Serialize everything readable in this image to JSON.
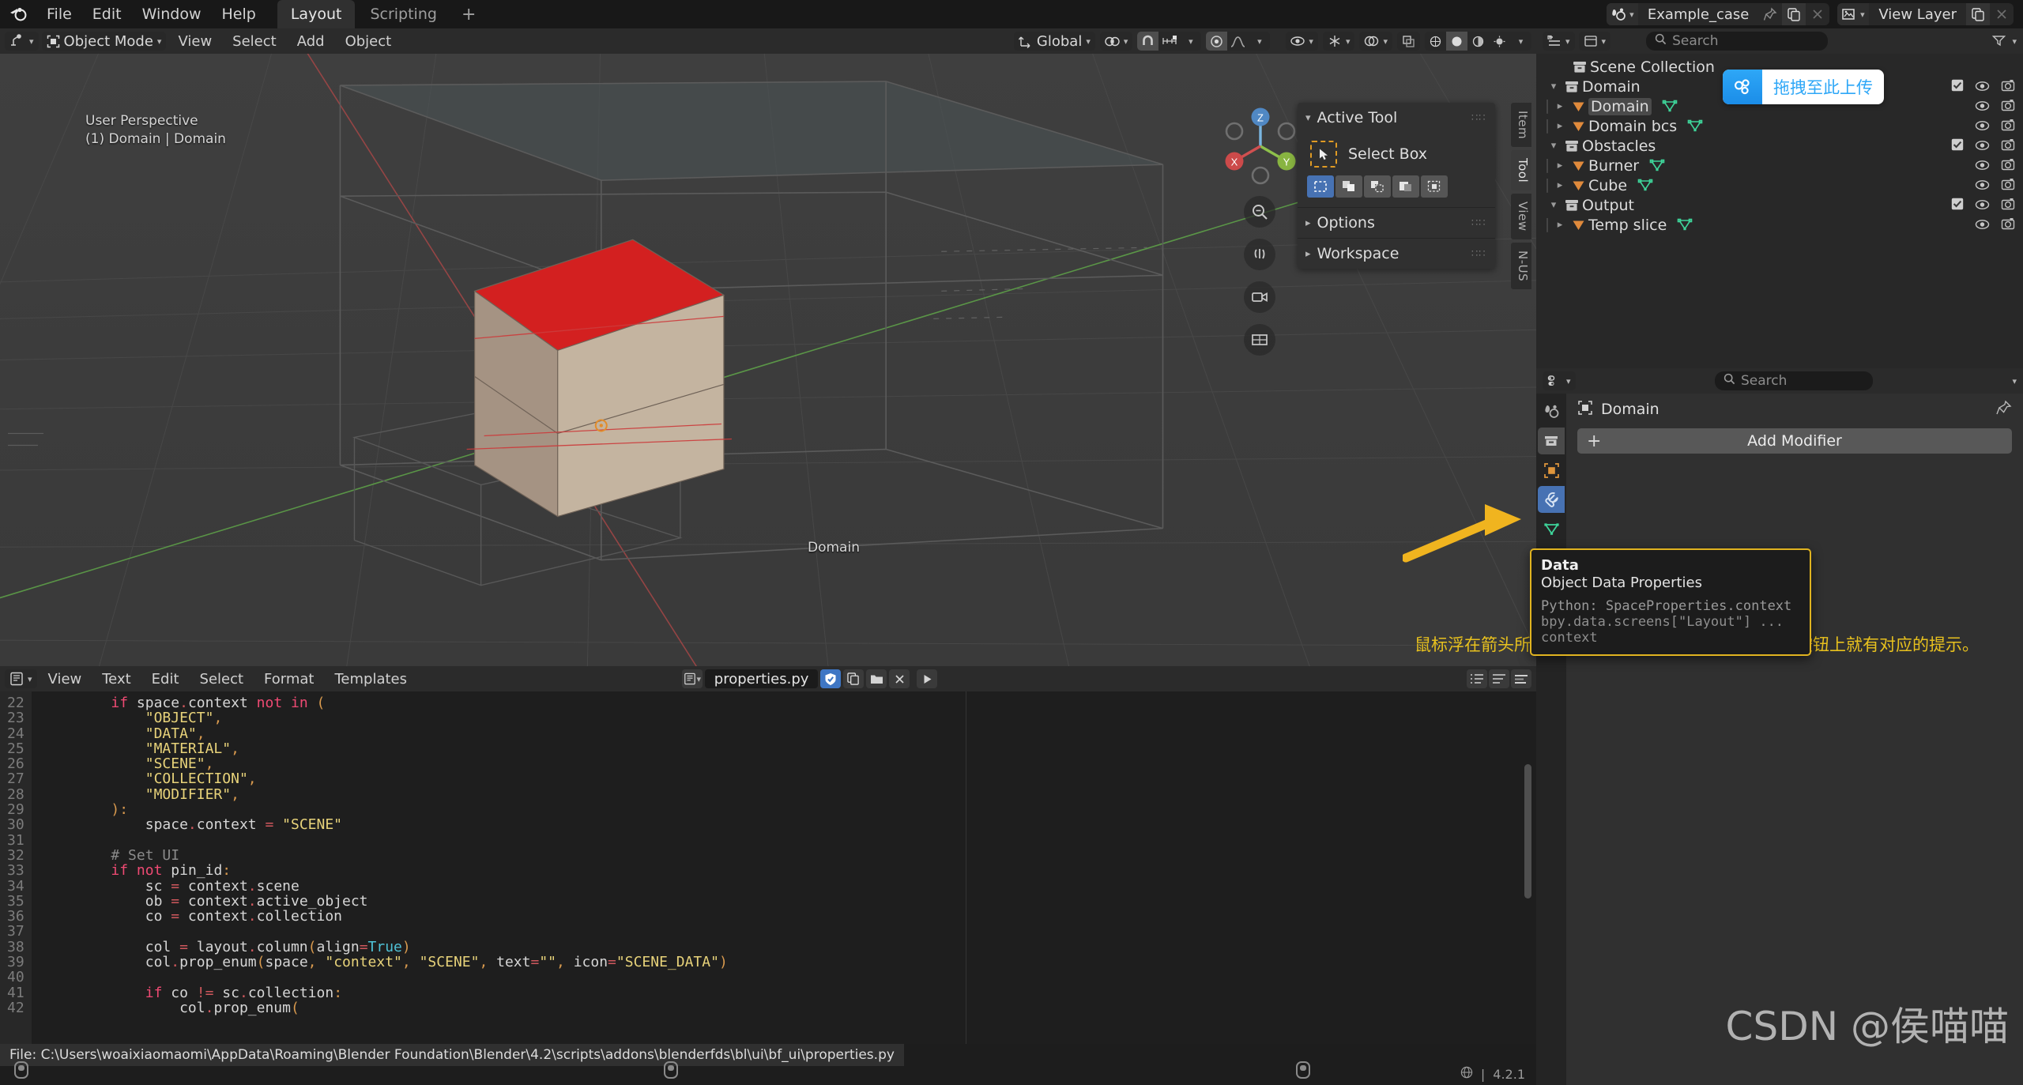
{
  "app": {
    "logo_icon": "blender-logo-icon",
    "version": "4.2.1"
  },
  "topbar": {
    "menus": [
      "File",
      "Edit",
      "Window",
      "Help"
    ],
    "workspaces": [
      {
        "label": "Layout",
        "active": true
      },
      {
        "label": "Scripting",
        "active": false
      }
    ],
    "add_workspace_label": "+",
    "scene": {
      "icon": "scene-icon",
      "name": "Example_case",
      "pin_icon": "pin-icon",
      "new_icon": "new-copy-icon",
      "unlink_icon": "close-icon"
    },
    "view_layer": {
      "icon": "view-layer-icon",
      "name": "View Layer",
      "new_icon": "new-copy-icon",
      "unlink_icon": "close-icon"
    }
  },
  "viewport": {
    "header": {
      "editor_type_icon": "editor-type-3dview-icon",
      "mode": "Object Mode",
      "mode_icon": "object-mode-icon",
      "menus": [
        "View",
        "Select",
        "Add",
        "Object"
      ],
      "transform_orientation": "Global",
      "orientation_icon": "orientation-gizmo-icon",
      "pivot_icon": "pivot-point-icon",
      "snap_magnet_icon": "snap-magnet-icon",
      "snap_target_icon": "snap-increment-icon",
      "proportional_icon": "proportional-editing-icon",
      "falloff_icon": "falloff-curve-icon",
      "shading_icons": [
        "wireframe-shading-icon",
        "solid-shading-icon",
        "material-shading-icon",
        "rendered-shading-icon"
      ],
      "overlay_icon": "overlays-icon",
      "xray_icon": "xray-toggle-icon",
      "gizmo_icon": "gizmo-toggle-icon",
      "visibility_icon": "object-visibility-icon"
    },
    "overlay_line1": "User Perspective",
    "overlay_line2": "(1) Domain | Domain",
    "object_label": "Domain",
    "gizmo_axes": [
      "X",
      "Y",
      "Z"
    ],
    "side_buttons": [
      "zoom-view-icon",
      "move-view-icon",
      "camera-view-icon",
      "toggle-ortho-icon"
    ]
  },
  "sidebar_n": {
    "sections": [
      {
        "label": "Active Tool",
        "expanded": true
      },
      {
        "label": "Options",
        "expanded": false
      },
      {
        "label": "Workspace",
        "expanded": false
      }
    ],
    "active_tool": {
      "name": "Select Box",
      "icon": "select-box-tool-icon",
      "modes": [
        "set-selection-icon",
        "extend-selection-icon",
        "subtract-selection-icon",
        "invert-selection-icon",
        "intersect-selection-icon"
      ],
      "active_mode_index": 0
    },
    "tabs": [
      "Item",
      "Tool",
      "View",
      "N-US"
    ]
  },
  "outliner": {
    "header": {
      "editor_type_icon": "editor-type-outliner-icon",
      "display_mode_icon": "outliner-display-mode-icon",
      "search_placeholder": "Search",
      "search_icon": "search-icon",
      "filter_icon": "filter-icon",
      "filter_chevron_icon": "chevron-down-icon"
    },
    "rows": [
      {
        "label": "Scene Collection",
        "icon": "collection-icon",
        "depth": 0,
        "twisty": "",
        "mesh": false,
        "checkbox": false,
        "eye": false,
        "camera": false
      },
      {
        "label": "Domain",
        "icon": "collection-icon",
        "depth": 1,
        "twisty": "v",
        "mesh": false,
        "checkbox": true,
        "eye": true,
        "camera": true
      },
      {
        "label": "Domain",
        "icon": "mesh-object-icon",
        "depth": 2,
        "twisty": ">",
        "mesh": true,
        "checkbox": false,
        "eye": true,
        "camera": true,
        "selected": true
      },
      {
        "label": "Domain bcs",
        "icon": "mesh-object-icon",
        "depth": 2,
        "twisty": ">",
        "mesh": true,
        "checkbox": false,
        "eye": true,
        "camera": true
      },
      {
        "label": "Obstacles",
        "icon": "collection-icon",
        "depth": 1,
        "twisty": "v",
        "mesh": false,
        "checkbox": true,
        "eye": true,
        "camera": true
      },
      {
        "label": "Burner",
        "icon": "mesh-object-icon",
        "depth": 2,
        "twisty": ">",
        "mesh": true,
        "checkbox": false,
        "eye": true,
        "camera": true
      },
      {
        "label": "Cube",
        "icon": "mesh-object-icon",
        "depth": 2,
        "twisty": ">",
        "mesh": true,
        "checkbox": false,
        "eye": true,
        "camera": true
      },
      {
        "label": "Output",
        "icon": "collection-icon",
        "depth": 1,
        "twisty": "v",
        "mesh": false,
        "checkbox": true,
        "eye": true,
        "camera": true
      },
      {
        "label": "Temp slice",
        "icon": "mesh-object-icon",
        "depth": 2,
        "twisty": ">",
        "mesh": true,
        "checkbox": false,
        "eye": true,
        "camera": true
      }
    ]
  },
  "properties": {
    "header": {
      "editor_type_icon": "editor-type-properties-icon",
      "search_placeholder": "Search",
      "search_icon": "search-icon",
      "options_chevron_icon": "chevron-down-icon"
    },
    "tabs": [
      {
        "name": "tool-properties-tab",
        "icon": "tool-tab-icon",
        "state": "normal"
      },
      {
        "name": "render-properties-tab",
        "icon": "collection-tab-icon",
        "state": "selected"
      },
      {
        "name": "object-properties-tab",
        "icon": "object-tab-icon",
        "state": "normal"
      },
      {
        "name": "modifier-properties-tab",
        "icon": "wrench-tab-icon",
        "state": "active"
      },
      {
        "name": "data-properties-tab",
        "icon": "mesh-data-tab-icon",
        "state": "normal"
      }
    ],
    "breadcrumb": {
      "icon": "object-icon",
      "label": "Domain",
      "pin_icon": "pin-icon"
    },
    "add_modifier_label": "Add Modifier",
    "add_modifier_plus": "+"
  },
  "tooltip": {
    "title": "Data",
    "subtitle": "Object Data Properties",
    "python_line": "Python: SpaceProperties.context",
    "path_line": "bpy.data.screens[\"Layout\"] ... context"
  },
  "annotation": {
    "text": "鼠标浮在箭头所指处，将有提示出现。只要浮在相关按钮上就有对应的提示。",
    "color": "#e8c11e",
    "arrow_color": "#f0b41f"
  },
  "text_editor": {
    "header": {
      "editor_type_icon": "editor-type-text-icon",
      "menus": [
        "View",
        "Text",
        "Edit",
        "Select",
        "Format",
        "Templates"
      ],
      "datablock_icon": "text-datablock-icon",
      "filename": "properties.py",
      "trusted_icon": "shield-check-icon",
      "copy_icon": "duplicate-icon",
      "open_icon": "folder-open-icon",
      "close_icon": "close-icon",
      "run_icon": "run-script-icon",
      "right_icons": [
        "line-numbers-icon",
        "word-wrap-icon",
        "syntax-highlight-icon"
      ]
    },
    "first_line_number": 22,
    "lines": [
      {
        "n": 22,
        "t": "        if space.context not in ("
      },
      {
        "n": 23,
        "t": "            \"OBJECT\","
      },
      {
        "n": 24,
        "t": "            \"DATA\","
      },
      {
        "n": 25,
        "t": "            \"MATERIAL\","
      },
      {
        "n": 26,
        "t": "            \"SCENE\","
      },
      {
        "n": 27,
        "t": "            \"COLLECTION\","
      },
      {
        "n": 28,
        "t": "            \"MODIFIER\","
      },
      {
        "n": 29,
        "t": "        ):"
      },
      {
        "n": 30,
        "t": "            space.context = \"SCENE\""
      },
      {
        "n": 31,
        "t": ""
      },
      {
        "n": 32,
        "t": "        # Set UI"
      },
      {
        "n": 33,
        "t": "        if not pin_id:"
      },
      {
        "n": 34,
        "t": "            sc = context.scene"
      },
      {
        "n": 35,
        "t": "            ob = context.active_object"
      },
      {
        "n": 36,
        "t": "            co = context.collection"
      },
      {
        "n": 37,
        "t": ""
      },
      {
        "n": 38,
        "t": "            col = layout.column(align=True)"
      },
      {
        "n": 39,
        "t": "            col.prop_enum(space, \"context\", \"SCENE\", text=\"\", icon=\"SCENE_DATA\")"
      },
      {
        "n": 40,
        "t": ""
      },
      {
        "n": 41,
        "t": "            if co != sc.collection:"
      },
      {
        "n": 42,
        "t": "                col.prop_enum("
      }
    ]
  },
  "statusbar": {
    "file_text": "File: C:\\Users\\woaixiaomaomi\\AppData\\Roaming\\Blender Foundation\\Blender\\4.2\\scripts\\addons\\blenderfds\\bl\\ui\\bf_ui\\properties.py",
    "mouse_hints": [
      "mouse-left-icon",
      "mouse-middle-icon",
      "mouse-right-icon"
    ],
    "version_label": "4.2.1",
    "globe_icon": "globe-icon"
  },
  "watermarks": {
    "upload_badge_text": "拖拽至此上传",
    "upload_badge_icon": "cloud-upload-icon",
    "csdn_text": "CSDN @侯喵喵"
  }
}
